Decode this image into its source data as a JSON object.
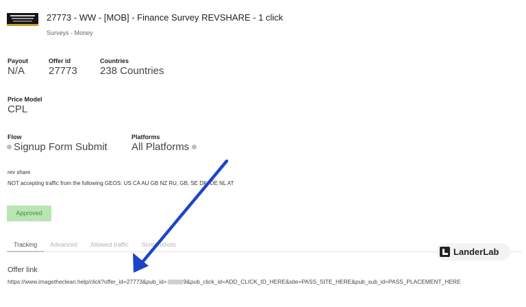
{
  "offer": {
    "title": "27773 - WW - [MOB] - Finance Survey REVSHARE - 1 click",
    "category": "Surveys - Money"
  },
  "stats": {
    "payout_label": "Payout",
    "payout_value": "N/A",
    "offer_id_label": "Offer id",
    "offer_id_value": "27773",
    "countries_label": "Countries",
    "countries_value": "238 Countries"
  },
  "price_model": {
    "label": "Price Model",
    "value": "CPL"
  },
  "flow": {
    "label": "Flow",
    "value": "Signup Form Submit"
  },
  "platforms": {
    "label": "Platforms",
    "value": "All Platforms"
  },
  "notes": {
    "line1": "rev share",
    "line2": "NOT accepting traffic from the following GEOS: US CA AU GB NZ RU, GB, SE DK, DE NL AT"
  },
  "status": {
    "label": "Approved",
    "color": "#b8e5b2"
  },
  "tabs": [
    {
      "label": "Tracking",
      "active": true
    },
    {
      "label": "Advanced",
      "active": false
    },
    {
      "label": "Allowed traffic",
      "active": false
    },
    {
      "label": "Screenshots",
      "active": false
    }
  ],
  "offer_link": {
    "label": "Offer link",
    "url_prefix": "https://www.imagetheclean.help/click?offer_id=27773&pub_id=",
    "url_suffix": "9&pub_click_id=ADD_CLICK_ID_HERE&site=PASS_SITE_HERE&pub_sub_id=PASS_PLACEMENT_HERE"
  },
  "watermark": {
    "text": "LanderLab",
    "icon": "landerlab-logo-icon"
  },
  "annotation": {
    "icon": "arrow-annotation-icon",
    "color": "#1c44c9"
  }
}
